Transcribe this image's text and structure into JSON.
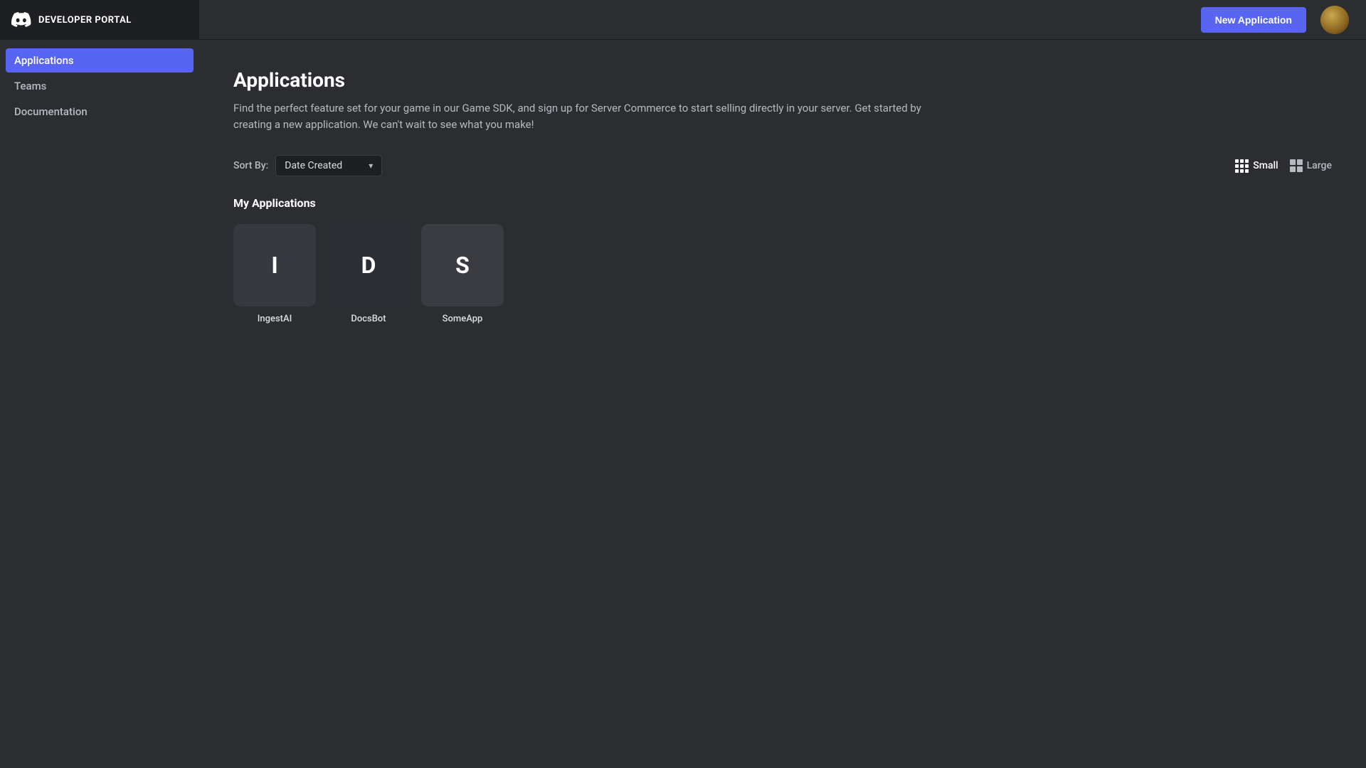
{
  "sidebar": {
    "logo_text": "DEVELOPER PORTAL",
    "items": [
      {
        "id": "applications",
        "label": "Applications",
        "active": true
      },
      {
        "id": "teams",
        "label": "Teams",
        "active": false
      },
      {
        "id": "documentation",
        "label": "Documentation",
        "active": false
      }
    ]
  },
  "header": {
    "new_app_button_label": "New Application"
  },
  "page": {
    "title": "Applications",
    "description": "Find the perfect feature set for your game in our Game SDK, and sign up for Server Commerce to start selling directly in your server. Get started by creating a new application. We can't wait to see what you make!"
  },
  "controls": {
    "sort_label": "Sort By:",
    "sort_value": "Date Created",
    "view_small_label": "Small",
    "view_large_label": "Large",
    "active_view": "small"
  },
  "applications": {
    "section_title": "My Applications",
    "items": [
      {
        "id": "ingestai",
        "initial": "I",
        "name": "IngestAI",
        "bg": "#36393f"
      },
      {
        "id": "docsbot",
        "initial": "D",
        "name": "DocsBot",
        "bg": "#2c2e35"
      },
      {
        "id": "someapp",
        "initial": "S",
        "name": "SomeApp",
        "bg": "#3a3c42"
      }
    ]
  }
}
